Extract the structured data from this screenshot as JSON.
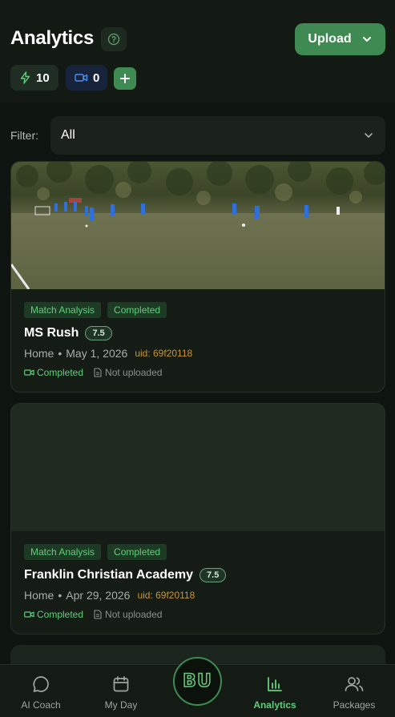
{
  "header": {
    "title": "Analytics",
    "upload_label": "Upload",
    "bolt_count": "10",
    "video_count": "0"
  },
  "filter": {
    "label": "Filter:",
    "selected": "All"
  },
  "cards": [
    {
      "tags": [
        "Match Analysis",
        "Completed"
      ],
      "name": "MS Rush",
      "score": "7.5",
      "location": "Home",
      "date": "May 1, 2026",
      "uid": "uid: 69f20118",
      "video_status": "Completed",
      "doc_status": "Not uploaded"
    },
    {
      "tags": [
        "Match Analysis",
        "Completed"
      ],
      "name": "Franklin Christian Academy",
      "score": "7.5",
      "location": "Home",
      "date": "Apr 29, 2026",
      "uid": "uid: 69f20118",
      "video_status": "Completed",
      "doc_status": "Not uploaded"
    }
  ],
  "tabbar": {
    "tabs": [
      {
        "label": "AI Coach",
        "icon": "chat-bubble-icon"
      },
      {
        "label": "My Day",
        "icon": "calendar-icon"
      },
      {
        "label": "Analytics",
        "icon": "bar-chart-icon",
        "active": true
      },
      {
        "label": "Packages",
        "icon": "users-icon"
      }
    ],
    "logo_text": "BU"
  },
  "colors": {
    "accent": "#3f8a52",
    "accent_text": "#5fd07a",
    "uid": "#c9962d",
    "background": "#0e140f"
  }
}
